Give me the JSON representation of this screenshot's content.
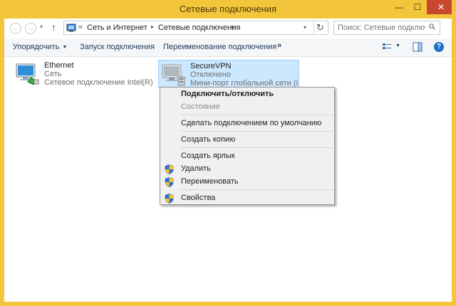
{
  "window": {
    "title": "Сетевые подключения",
    "accent_color": "#f3c53a",
    "close_color": "#c7472f",
    "min_glyph": "—",
    "max_glyph": "☐",
    "close_glyph": "✕"
  },
  "navigation": {
    "back_glyph": "←",
    "forward_glyph": "→",
    "recent_glyph": "▾",
    "up_glyph": "↑",
    "address": {
      "overflow_glyph": "«",
      "crumbs": [
        "Сеть и Интернет",
        "Сетевые подключения"
      ],
      "separator_glyph": "▸",
      "dropdown_glyph": "▾",
      "refresh_glyph": "↻"
    },
    "search": {
      "placeholder": "Поиск: Сетевые подключения"
    }
  },
  "command_bar": {
    "organize": "Упорядочить",
    "organize_drop": "▼",
    "start_connection": "Запуск подключения",
    "rename_connection": "Переименование подключения",
    "more": "»",
    "view_drop": "▼",
    "help_glyph": "?"
  },
  "connections": [
    {
      "name": "Ethernet",
      "status": "Сеть",
      "device": "Сетевое подключение Intel(R) P...",
      "icon": "network-adapter-icon",
      "selected": false
    },
    {
      "name": "SecureVPN",
      "status": "Отключено",
      "device": "Мини-порт глобальной сети (IK...",
      "icon": "vpn-adapter-icon",
      "selected": true
    }
  ],
  "context_menu": {
    "items": [
      {
        "label": "Подключить/отключить",
        "bold": true,
        "disabled": false,
        "shield": false
      },
      {
        "label": "Состояние",
        "bold": false,
        "disabled": true,
        "shield": false
      },
      {
        "label": "Сделать подключением по умолчанию",
        "bold": false,
        "disabled": false,
        "shield": false
      },
      {
        "label": "Создать копию",
        "bold": false,
        "disabled": false,
        "shield": false
      },
      {
        "label": "Создать ярлык",
        "bold": false,
        "disabled": false,
        "shield": false
      },
      {
        "label": "Удалить",
        "bold": false,
        "disabled": false,
        "shield": true
      },
      {
        "label": "Переименовать",
        "bold": false,
        "disabled": false,
        "shield": true
      },
      {
        "label": "Свойства",
        "bold": false,
        "disabled": false,
        "shield": true
      }
    ]
  }
}
